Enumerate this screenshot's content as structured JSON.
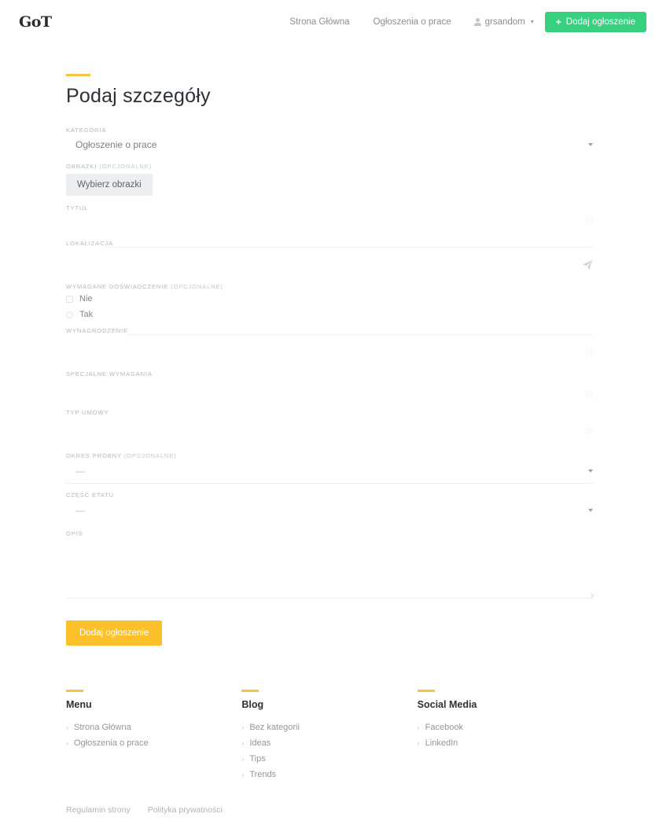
{
  "header": {
    "logo_text": "GoT",
    "nav": [
      {
        "label": "Strona Główna"
      },
      {
        "label": "Ogłoszenia o prace"
      }
    ],
    "user": {
      "name": "grsandom",
      "caret": "▾",
      "icon": "user-icon"
    },
    "add_button": {
      "label": "Dodaj ogłoszenie",
      "plus": "+",
      "color": "#36d07f"
    }
  },
  "page": {
    "title": "Podaj szczegóły",
    "accent_color": "#f6c445"
  },
  "form": {
    "category": {
      "label": "KATEGORIA",
      "value": "Ogłoszenie o prace",
      "arrow": "chevron-down-icon"
    },
    "images": {
      "label": "OBRAZKI",
      "optional": "(OPCJONALNE)",
      "button_label": "Wybierz obrazki"
    },
    "title_field": {
      "label": "TYTUŁ",
      "value": ""
    },
    "location": {
      "label": "LOKALIZACJA",
      "value": "",
      "icon": "send-icon"
    },
    "experience": {
      "label": "WYMAGANE DOŚWIADCZENIE",
      "optional": "(OPCJONALNE)",
      "options": [
        {
          "label": "Nie",
          "checked": false
        },
        {
          "label": "Tak",
          "checked": false
        }
      ]
    },
    "salary": {
      "label": "WYNAGRODZENIE",
      "value": ""
    },
    "special_requirements": {
      "label": "SPECJALNE WYMAGANIA",
      "value": ""
    },
    "contract_type": {
      "label": "TYP UMOWY",
      "value": ""
    },
    "trial_period": {
      "label": "OKRES PRÓBNY",
      "optional": "(OPCJONALNE)",
      "value": "—"
    },
    "part_time": {
      "label": "CZĘŚĆ ETATU",
      "value": "—"
    },
    "description": {
      "label": "OPIS",
      "value": ""
    },
    "submit": {
      "label": "Dodaj ogłoszenie",
      "color": "#fcc12a"
    }
  },
  "footer": {
    "columns": [
      {
        "heading": "Menu",
        "links": [
          {
            "label": "Strona Główna"
          },
          {
            "label": "Ogłoszenia o prace"
          }
        ]
      },
      {
        "heading": "Blog",
        "links": [
          {
            "label": "Bez kategorii"
          },
          {
            "label": "Ideas"
          },
          {
            "label": "Tips"
          },
          {
            "label": "Trends"
          }
        ]
      },
      {
        "heading": "Social Media",
        "links": [
          {
            "label": "Facebook"
          },
          {
            "label": "LinkedIn"
          }
        ]
      }
    ],
    "chevron": "›",
    "legal": [
      {
        "label": "Regulamin strony"
      },
      {
        "label": "Polityka prywatności"
      }
    ]
  }
}
